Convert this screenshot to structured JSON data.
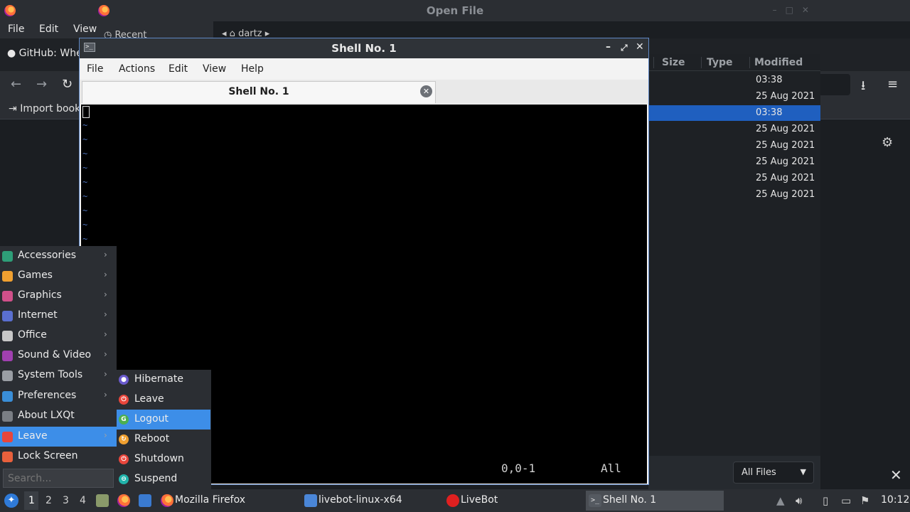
{
  "firefox": {
    "window_title": "Open File",
    "menu": [
      "File",
      "Edit",
      "View"
    ],
    "tab_title": "GitHub: Whe",
    "import_bookmarks": "Import book"
  },
  "open_file": {
    "recent_label": "Recent",
    "path_label": "dartz",
    "columns": [
      "Size",
      "Type",
      "Modified"
    ],
    "modified": [
      "03:38",
      "25 Aug 2021",
      "03:38",
      "25 Aug 2021",
      "25 Aug 2021",
      "25 Aug 2021",
      "25 Aug 2021",
      "25 Aug 2021"
    ],
    "selected_row": 2,
    "filter": "All Files"
  },
  "shell": {
    "title": "Shell No. 1",
    "menu": [
      "File",
      "Actions",
      "Edit",
      "View",
      "Help"
    ],
    "tab_label": "Shell No. 1",
    "tilde": "~",
    "status_position": "0,0-1",
    "status_scroll": "All"
  },
  "lxqt_menu": {
    "items": [
      {
        "label": "Accessories",
        "icon": "accessories-icon",
        "color": "#2e9e78"
      },
      {
        "label": "Games",
        "icon": "games-icon",
        "color": "#f0a030"
      },
      {
        "label": "Graphics",
        "icon": "graphics-icon",
        "color": "#d0508a"
      },
      {
        "label": "Internet",
        "icon": "internet-icon",
        "color": "#5a6fd0"
      },
      {
        "label": "Office",
        "icon": "office-icon",
        "color": "#c8c8c8"
      },
      {
        "label": "Sound & Video",
        "icon": "sound-video-icon",
        "color": "#a040b0"
      },
      {
        "label": "System Tools",
        "icon": "system-tools-icon",
        "color": "#9a9ea4"
      },
      {
        "label": "Preferences",
        "icon": "preferences-icon",
        "color": "#3a8ed8"
      },
      {
        "label": "About LXQt",
        "icon": "about-icon",
        "color": "#7a7e84"
      },
      {
        "label": "Leave",
        "icon": "leave-icon",
        "color": "#e8463c"
      },
      {
        "label": "Lock Screen",
        "icon": "lock-screen-icon",
        "color": "#e8603c"
      }
    ],
    "search_placeholder": "Search..."
  },
  "leave_submenu": {
    "items": [
      {
        "label": "Hibernate",
        "icon": "hibernate-icon",
        "color": "#6a5acd"
      },
      {
        "label": "Leave",
        "icon": "leave-icon",
        "color": "#e8463c"
      },
      {
        "label": "Logout",
        "icon": "logout-icon",
        "color": "#4caf50"
      },
      {
        "label": "Reboot",
        "icon": "reboot-icon",
        "color": "#f0a030"
      },
      {
        "label": "Shutdown",
        "icon": "shutdown-icon",
        "color": "#e8463c"
      },
      {
        "label": "Suspend",
        "icon": "suspend-icon",
        "color": "#20b2aa"
      }
    ],
    "active": "Logout"
  },
  "taskbar": {
    "workspaces": [
      "1",
      "2",
      "3",
      "4"
    ],
    "tasks": [
      {
        "label": "Mozilla Firefox",
        "icon": "firefox-icon"
      },
      {
        "label": "livebot-linux-x64",
        "icon": "folder-icon"
      },
      {
        "label": "LiveBot",
        "icon": "livebot-icon"
      },
      {
        "label": "Shell No. 1",
        "icon": "terminal-icon"
      }
    ],
    "clock": "10:12"
  }
}
